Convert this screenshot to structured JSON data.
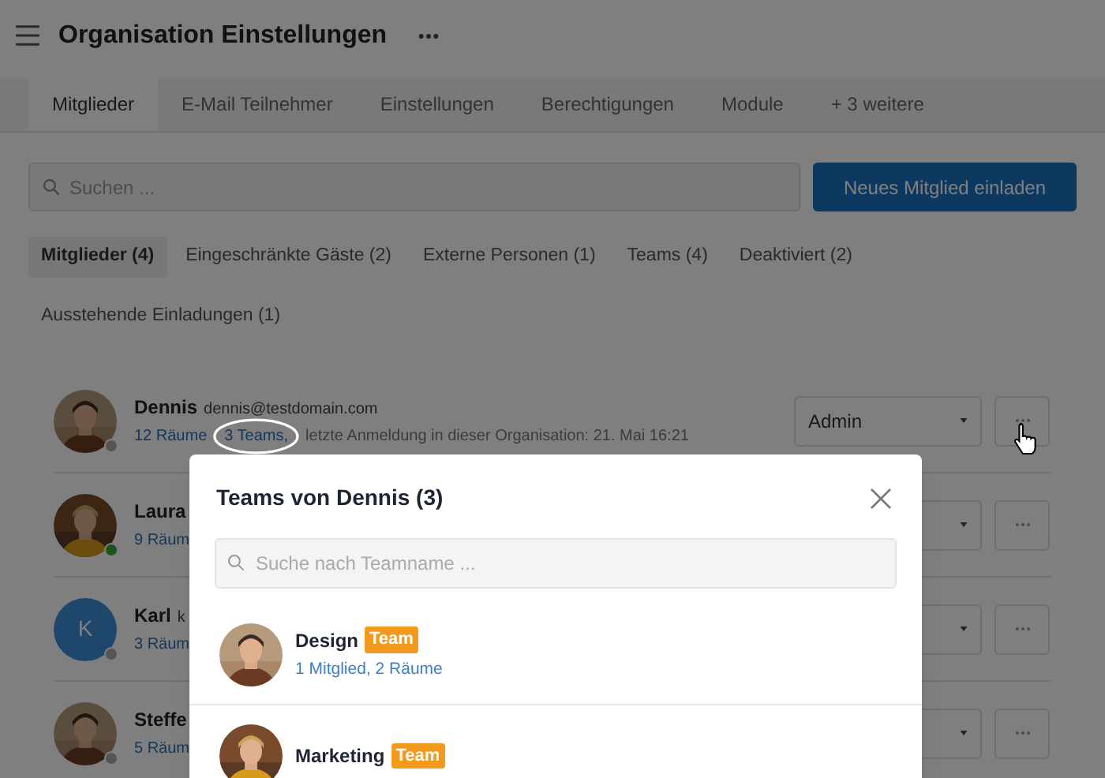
{
  "header": {
    "title": "Organisation Einstellungen"
  },
  "tabs": [
    {
      "label": "Mitglieder",
      "selected": true
    },
    {
      "label": "E-Mail Teilnehmer",
      "selected": false
    },
    {
      "label": "Einstellungen",
      "selected": false
    },
    {
      "label": "Berechtigungen",
      "selected": false
    },
    {
      "label": "Module",
      "selected": false
    },
    {
      "label": "+ 3 weitere",
      "selected": false
    }
  ],
  "search": {
    "placeholder": "Suchen ..."
  },
  "invite_button": "Neues Mitglied einladen",
  "filters": [
    {
      "label": "Mitglieder (4)",
      "selected": true
    },
    {
      "label": "Eingeschränkte Gäste (2)",
      "selected": false
    },
    {
      "label": "Externe Personen (1)",
      "selected": false
    },
    {
      "label": "Teams (4)",
      "selected": false
    },
    {
      "label": "Deaktiviert (2)",
      "selected": false
    },
    {
      "label": "Ausstehende Einladungen (1)",
      "selected": false
    }
  ],
  "members": [
    {
      "name": "Dennis",
      "email": "dennis@testdomain.com",
      "online": false,
      "rooms": "12 Räume",
      "teams": "3 Teams,",
      "last_login": "letzte Anmeldung in dieser Organisation: 21. Mai 16:21",
      "role": "Admin"
    },
    {
      "name": "Laura",
      "online": true,
      "rooms": "9 Räum"
    },
    {
      "name": "Karl",
      "email": "k",
      "avatar": {
        "kind": "initial",
        "initial": "K"
      },
      "online": false,
      "rooms": "3 Räum"
    },
    {
      "name": "Steffe",
      "online": false,
      "rooms": "5 Räum"
    }
  ],
  "modal": {
    "title": "Teams von Dennis (3)",
    "search_placeholder": "Suche nach Teamname ...",
    "teams": [
      {
        "name": "Design",
        "badge": "Team",
        "details": "1 Mitglied, 2 Räume"
      },
      {
        "name": "Marketing",
        "badge": "Team"
      }
    ]
  }
}
